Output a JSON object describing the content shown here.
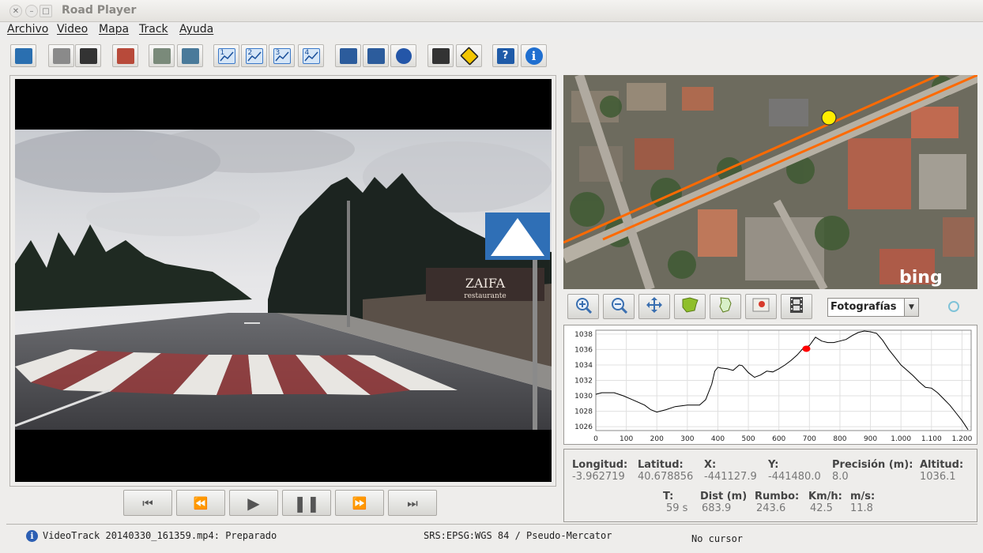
{
  "window": {
    "title": "Road Player"
  },
  "menu": [
    "Archivo",
    "Video",
    "Mapa",
    "Track",
    "Ayuda"
  ],
  "toolbar": [
    {
      "name": "open-video-icon",
      "color": "#2a6fb0"
    },
    {
      "name": "camera-icon",
      "color": "#8a8a8a"
    },
    {
      "name": "film-icon",
      "color": "#333333"
    },
    {
      "name": "map-edit-icon",
      "color": "#b84a3a"
    },
    {
      "name": "database-add-icon",
      "color": "#7a8a7a"
    },
    {
      "name": "layers-icon",
      "color": "#4a7a9a"
    },
    {
      "name": "chart-1-icon",
      "color": "#3a78c8"
    },
    {
      "name": "chart-2-icon",
      "color": "#3a78c8"
    },
    {
      "name": "chart-3-icon",
      "color": "#3a78c8"
    },
    {
      "name": "chart-4-icon",
      "color": "#3a78c8"
    },
    {
      "name": "save-icon",
      "color": "#2c5c9c"
    },
    {
      "name": "save-as-icon",
      "color": "#2c5c9c"
    },
    {
      "name": "globe-icon",
      "color": "#2456a8"
    },
    {
      "name": "pen-icon",
      "color": "#333333"
    },
    {
      "name": "warning-sign-icon",
      "color": "#f2c500"
    },
    {
      "name": "help-book-icon",
      "color": "#1f5ba8"
    },
    {
      "name": "info-icon",
      "color": "#1f6fd0"
    }
  ],
  "video": {
    "sign_text": "ZAIFA",
    "sign_sub": "restaurante"
  },
  "map": {
    "watermark": "bing",
    "layer_select": "Fotografías"
  },
  "chart_data": {
    "type": "line",
    "title": "",
    "xlabel": "",
    "ylabel": "",
    "xlim": [
      0,
      1230
    ],
    "ylim": [
      1025.5,
      1038.5
    ],
    "xticks": [
      0,
      100,
      200,
      300,
      400,
      500,
      600,
      700,
      800,
      900,
      1000,
      1100,
      1200
    ],
    "xtick_labels": [
      "0",
      "100",
      "200",
      "300",
      "400",
      "500",
      "600",
      "700",
      "800",
      "900",
      "1.000",
      "1.100",
      "1.200"
    ],
    "yticks": [
      1026,
      1028,
      1030,
      1032,
      1034,
      1036,
      1038
    ],
    "series": [
      {
        "x": [
          0,
          20,
          60,
          90,
          120,
          160,
          180,
          200,
          230,
          260,
          300,
          340,
          360,
          380,
          390,
          400,
          410,
          430,
          450,
          470,
          480,
          500,
          520,
          540,
          560,
          580,
          600,
          620,
          640,
          660,
          680,
          700,
          720,
          740,
          760,
          780,
          800,
          820,
          840,
          860,
          880,
          900,
          920,
          940,
          960,
          980,
          1000,
          1020,
          1040,
          1060,
          1080,
          1100,
          1120,
          1140,
          1160,
          1180,
          1200,
          1210,
          1220
        ],
        "y": [
          1030.2,
          1030.4,
          1030.4,
          1030.0,
          1029.5,
          1028.8,
          1028.2,
          1027.9,
          1028.2,
          1028.6,
          1028.8,
          1028.8,
          1029.5,
          1031.5,
          1033.2,
          1033.7,
          1033.6,
          1033.5,
          1033.3,
          1034.0,
          1033.9,
          1033.0,
          1032.4,
          1032.7,
          1033.2,
          1033.1,
          1033.5,
          1034.0,
          1034.6,
          1035.3,
          1036.2,
          1036.5,
          1037.6,
          1037.1,
          1036.9,
          1036.9,
          1037.1,
          1037.3,
          1037.8,
          1038.2,
          1038.4,
          1038.3,
          1038.1,
          1037.2,
          1036.0,
          1035.0,
          1034.0,
          1033.3,
          1032.6,
          1031.8,
          1031.1,
          1031.0,
          1030.4,
          1029.6,
          1028.8,
          1027.8,
          1026.8,
          1026.2,
          1025.6
        ]
      }
    ],
    "marker": {
      "x": 690,
      "y": 1036.1,
      "color": "#ff0000"
    },
    "line_color": "#000000",
    "grid": true
  },
  "info": {
    "longitud_label": "Longitud:",
    "longitud": "-3.962719",
    "latitud_label": "Latitud:",
    "latitud": "40.678856",
    "x_label": "X:",
    "x": "-441127.9",
    "y_label": "Y:",
    "y": "-441480.0",
    "precision_label": "Precisión (m):",
    "precision": "8.0",
    "altitud_label": "Altitud:",
    "altitud": "1036.1",
    "t_label": "T:",
    "t": "59 s",
    "dist_label": "Dist (m)",
    "dist": "683.9",
    "rumbo_label": "Rumbo:",
    "rumbo": "243.6",
    "kmh_label": "Km/h:",
    "kmh": "42.5",
    "ms_label": "m/s:",
    "ms": "11.8"
  },
  "status": {
    "message": "VideoTrack 20140330_161359.mp4: Preparado",
    "srs": "SRS:EPSG:WGS 84 / Pseudo-Mercator",
    "cursor": "No cursor"
  }
}
